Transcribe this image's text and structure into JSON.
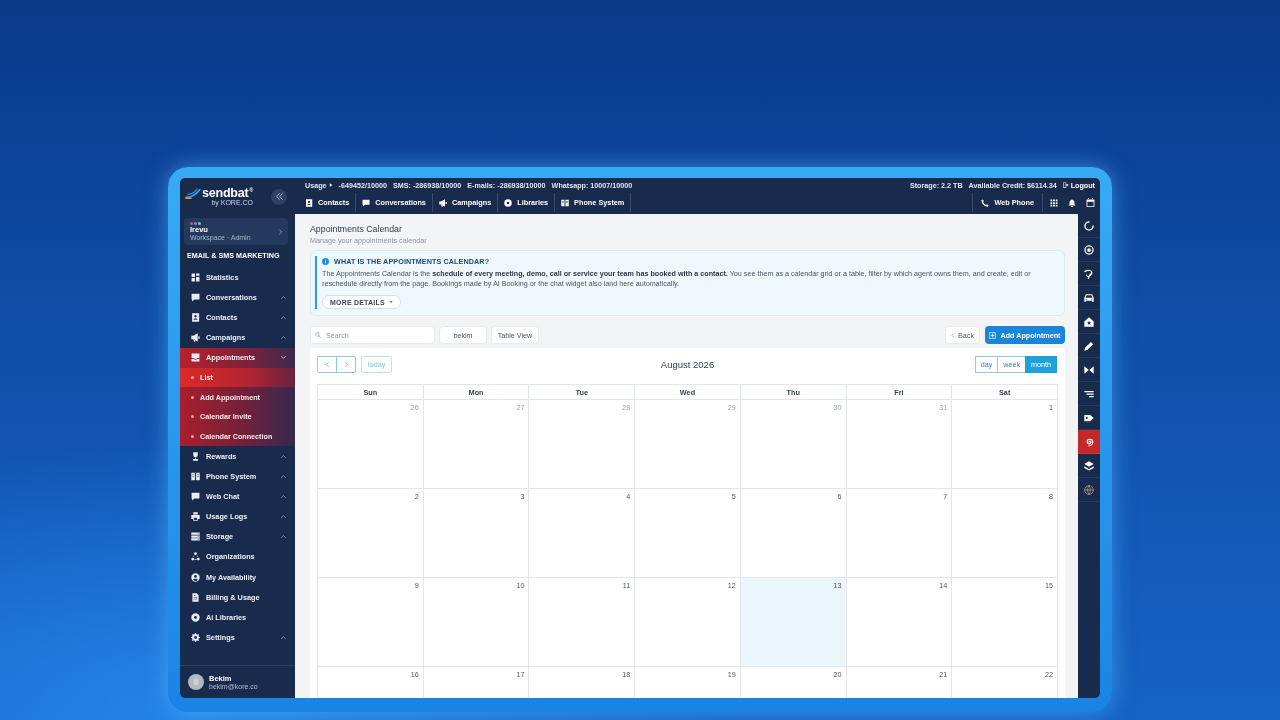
{
  "top_bar": {
    "logo": {
      "wordmark": "sendbat$^{®}$",
      "tagline": "by KORE.CO"
    },
    "usage": {
      "label": "Usage",
      "items": [
        "-649452/10000",
        "SMS: -286938/10000",
        "E-mails: -286938/10000",
        "Whatsapp: 10007/10000"
      ]
    },
    "account": {
      "storage": "Storage: 2.2 TB",
      "credit": "Available Credit: $6114.34",
      "logout": "Logout"
    },
    "nav": [
      "Contacts",
      "Conversations",
      "Campaigns",
      "Libraries",
      "Phone System"
    ],
    "web_phone": "Web Phone"
  },
  "sidebar": {
    "workspace": {
      "name": "Irevu",
      "role": "Workspace · Admin"
    },
    "section": "EMAIL & SMS MARKETING",
    "menu": [
      {
        "kind": "link",
        "label": "Statistics"
      },
      {
        "kind": "group",
        "label": "Conversations",
        "expanded": false
      },
      {
        "kind": "group",
        "label": "Contacts",
        "expanded": false
      },
      {
        "kind": "group",
        "label": "Campaigns",
        "expanded": false
      },
      {
        "kind": "group",
        "label": "Appointments",
        "expanded": true,
        "children": [
          {
            "label": "List",
            "selected": true
          },
          {
            "label": "Add Appointment",
            "selected": false
          },
          {
            "label": "Calendar Invite",
            "selected": false
          },
          {
            "label": "Calendar Connection",
            "selected": false
          }
        ]
      },
      {
        "kind": "group",
        "label": "Rewards",
        "expanded": false
      },
      {
        "kind": "group",
        "label": "Phone System",
        "expanded": false
      },
      {
        "kind": "group",
        "label": "Web Chat",
        "expanded": false
      },
      {
        "kind": "group",
        "label": "Usage Logs",
        "expanded": false
      },
      {
        "kind": "group",
        "label": "Storage",
        "expanded": false
      },
      {
        "kind": "link",
        "label": "Organizations"
      },
      {
        "kind": "link",
        "label": "My Availability"
      },
      {
        "kind": "link",
        "label": "Billing & Usage"
      },
      {
        "kind": "link",
        "label": "Ai Libraries"
      },
      {
        "kind": "group",
        "label": "Settings",
        "expanded": false
      }
    ],
    "user": {
      "name": "Bekim",
      "email": "bekim@kore.co"
    }
  },
  "page": {
    "title": "Appointments Calendar",
    "subtitle": "Manage your appointments calendar"
  },
  "info": {
    "title": "WHAT IS THE APPOINTMENTS CALENDAR?",
    "text": "The Appointments Calendar is the **schedule of every meeting, demo, call or service your team has booked with a contact.** You see them as a calendar grid or a table, filter by which agent owns them, and create, edit or reschedule directly from the page. Bookings made by AI Booking or the chat widget also land here automatically.",
    "button": "MORE DETAILS"
  },
  "toolbar": {
    "search": {
      "placeholder": "Search"
    },
    "agent_filter": "bekim",
    "table_view": "Table View",
    "back": "Back",
    "add": "Add Appointment"
  },
  "calendar": {
    "today_button": {
      "label": "today",
      "disabled": true
    },
    "title": "August 2026",
    "views": [
      {
        "label": "day",
        "selected": false
      },
      {
        "label": "week",
        "selected": false
      },
      {
        "label": "month",
        "selected": true
      }
    ],
    "weekdays": [
      "Sun",
      "Mon",
      "Tue",
      "Wed",
      "Thu",
      "Fri",
      "Sat"
    ],
    "weeks": [
      [
        {
          "day": "26",
          "outside": true,
          "today": false
        },
        {
          "day": "27",
          "outside": true,
          "today": false
        },
        {
          "day": "28",
          "outside": true,
          "today": false
        },
        {
          "day": "29",
          "outside": true,
          "today": false
        },
        {
          "day": "30",
          "outside": true,
          "today": false
        },
        {
          "day": "31",
          "outside": true,
          "today": false
        },
        {
          "day": "1",
          "outside": false,
          "today": false
        }
      ],
      [
        {
          "day": "2",
          "outside": false,
          "today": false
        },
        {
          "day": "3",
          "outside": false,
          "today": false
        },
        {
          "day": "4",
          "outside": false,
          "today": false
        },
        {
          "day": "5",
          "outside": false,
          "today": false
        },
        {
          "day": "6",
          "outside": false,
          "today": false
        },
        {
          "day": "7",
          "outside": false,
          "today": false
        },
        {
          "day": "8",
          "outside": false,
          "today": false
        }
      ],
      [
        {
          "day": "9",
          "outside": false,
          "today": false
        },
        {
          "day": "10",
          "outside": false,
          "today": false
        },
        {
          "day": "11",
          "outside": false,
          "today": false
        },
        {
          "day": "12",
          "outside": false,
          "today": false
        },
        {
          "day": "13",
          "outside": false,
          "today": true
        },
        {
          "day": "14",
          "outside": false,
          "today": false
        },
        {
          "day": "15",
          "outside": false,
          "today": false
        }
      ],
      [
        {
          "day": "16",
          "outside": false,
          "today": false
        },
        {
          "day": "17",
          "outside": false,
          "today": false
        },
        {
          "day": "18",
          "outside": false,
          "today": false
        },
        {
          "day": "19",
          "outside": false,
          "today": false
        },
        {
          "day": "20",
          "outside": false,
          "today": false
        },
        {
          "day": "21",
          "outside": false,
          "today": false
        },
        {
          "day": "22",
          "outside": false,
          "today": false
        }
      ]
    ]
  },
  "right_rail": [
    {
      "selected": false
    },
    {
      "selected": false
    },
    {
      "selected": false
    },
    {
      "selected": false
    },
    {
      "selected": false
    },
    {
      "selected": false
    },
    {
      "selected": false
    },
    {
      "selected": false
    },
    {
      "selected": false
    },
    {
      "selected": true
    },
    {
      "selected": false
    },
    {
      "selected": false
    }
  ]
}
